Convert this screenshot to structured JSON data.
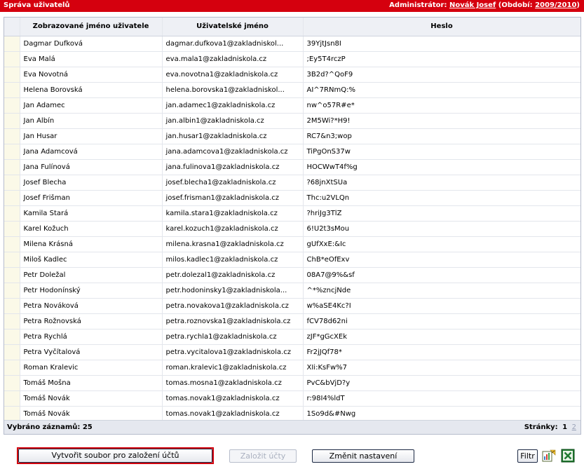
{
  "header": {
    "title": "Správa uživatelů",
    "admin_label": "Administrátor:",
    "admin_name": "Novák Josef",
    "period_label": "(Období:",
    "period_value": "2009/2010",
    "period_close": ")"
  },
  "table": {
    "columns": [
      "Zobrazované jméno uživatele",
      "Uživatelské jméno",
      "Heslo"
    ],
    "rows": [
      {
        "name": "Dagmar Dufková",
        "user": "dagmar.dufkova1@zakladniskol...",
        "pwd": "39YjtJsn8I"
      },
      {
        "name": "Eva Malá",
        "user": "eva.mala1@zakladniskola.cz",
        "pwd": ";Ey5T4rczP"
      },
      {
        "name": "Eva Novotná",
        "user": "eva.novotna1@zakladniskola.cz",
        "pwd": "3B2d?^QoF9"
      },
      {
        "name": "Helena Borovská",
        "user": "helena.borovska1@zakladniskol...",
        "pwd": "AI^7RNmQ:%"
      },
      {
        "name": "Jan Adamec",
        "user": "jan.adamec1@zakladniskola.cz",
        "pwd": "nw^o57R#e*"
      },
      {
        "name": "Jan Albín",
        "user": "jan.albin1@zakladniskola.cz",
        "pwd": "2M5Wi?*H9!"
      },
      {
        "name": "Jan Husar",
        "user": "jan.husar1@zakladniskola.cz",
        "pwd": "RC7&n3;wop"
      },
      {
        "name": "Jana Adamcová",
        "user": "jana.adamcova1@zakladniskola.cz",
        "pwd": "TiPgOnS37w"
      },
      {
        "name": "Jana Fulínová",
        "user": "jana.fulinova1@zakladniskola.cz",
        "pwd": "HOCWwT4f%g"
      },
      {
        "name": "Josef Blecha",
        "user": "josef.blecha1@zakladniskola.cz",
        "pwd": "?68jnXtSUa"
      },
      {
        "name": "Josef Frišman",
        "user": "josef.frisman1@zakladniskola.cz",
        "pwd": "Thc:u2VLQn"
      },
      {
        "name": "Kamila Stará",
        "user": "kamila.stara1@zakladniskola.cz",
        "pwd": "?hriJg3TlZ"
      },
      {
        "name": "Karel Kožuch",
        "user": "karel.kozuch1@zakladniskola.cz",
        "pwd": "6!U2t3sMou"
      },
      {
        "name": "Milena Krásná",
        "user": "milena.krasna1@zakladniskola.cz",
        "pwd": "gUfXxE:&Ic"
      },
      {
        "name": "Miloš Kadlec",
        "user": "milos.kadlec1@zakladniskola.cz",
        "pwd": "ChB*eOfExv"
      },
      {
        "name": "Petr Doležal",
        "user": "petr.dolezal1@zakladniskola.cz",
        "pwd": "08A7@9%&sf"
      },
      {
        "name": "Petr Hodonínský",
        "user": "petr.hodoninsky1@zakladniskola...",
        "pwd": "^*%zncjNde"
      },
      {
        "name": "Petra Nováková",
        "user": "petra.novakova1@zakladniskola.cz",
        "pwd": "w%aSE4Kc?I"
      },
      {
        "name": "Petra Rožnovská",
        "user": "petra.roznovska1@zakladniskola.cz",
        "pwd": "fCV78d62ni"
      },
      {
        "name": "Petra Rychlá",
        "user": "petra.rychla1@zakladniskola.cz",
        "pwd": "zJF*gGcXEk"
      },
      {
        "name": "Petra Vyčítalová",
        "user": "petra.vycitalova1@zakladniskola.cz",
        "pwd": "Fr2jJQf78*"
      },
      {
        "name": "Roman Kralevic",
        "user": "roman.kralevic1@zakladniskola.cz",
        "pwd": "XIi:KsFw%7"
      },
      {
        "name": "Tomáš Mošna",
        "user": "tomas.mosna1@zakladniskola.cz",
        "pwd": "PvC&bVjD?y"
      },
      {
        "name": "Tomáš Novák",
        "user": "tomas.novak1@zakladniskola.cz",
        "pwd": "r:98I4%ldT"
      },
      {
        "name": "Tomáš Novák",
        "user": "tomas.novak1@zakladniskola.cz",
        "pwd": "1So9d&#Nwg"
      }
    ]
  },
  "footer": {
    "count_label": "Vybráno záznamů: 25",
    "pages_label": "Stránky:",
    "page_current": "1",
    "page_other": "2"
  },
  "buttons": {
    "create_file": "Vytvořit soubor pro založení účtů",
    "create_accounts": "Založit účty",
    "change_settings": "Změnit nastavení",
    "filter": "Filtr"
  },
  "icons": {
    "export_1": "spreadsheet-chart-icon",
    "export_2": "excel-icon"
  },
  "colors": {
    "title_bar": "#d5000e",
    "highlight_border": "#d2000c"
  }
}
